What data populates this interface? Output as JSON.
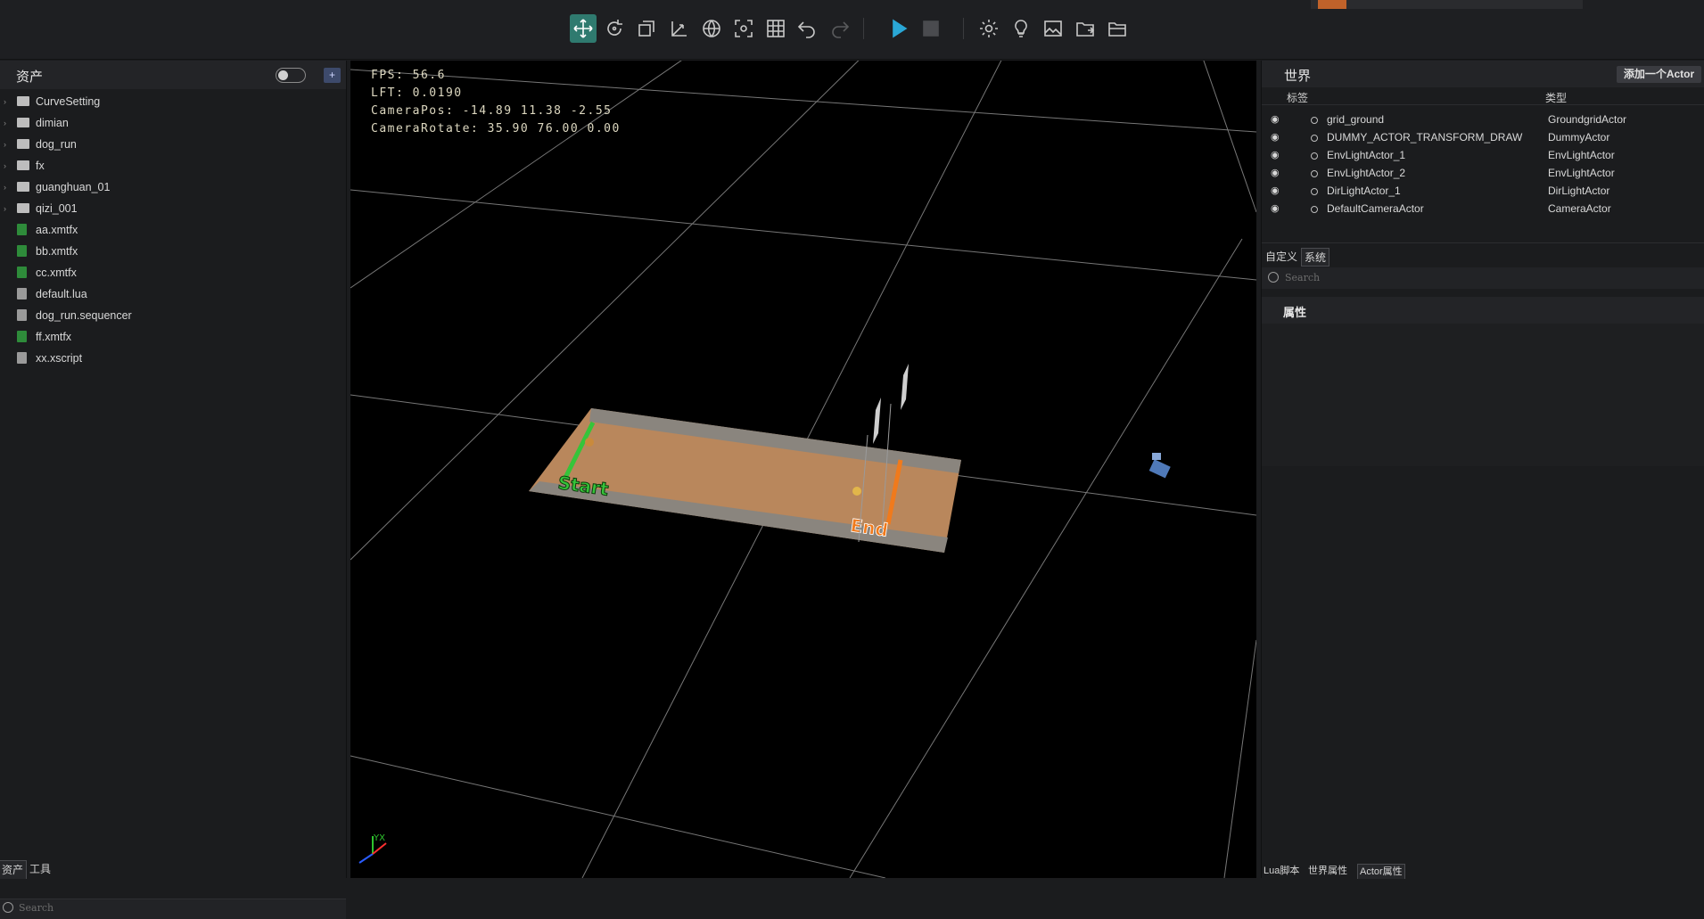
{
  "toolbar": {
    "buttons": [
      {
        "name": "move-icon"
      },
      {
        "name": "rotate-icon"
      },
      {
        "name": "scale-icon"
      },
      {
        "name": "axis-icon"
      },
      {
        "name": "globe-icon"
      },
      {
        "name": "focus-icon"
      },
      {
        "name": "grid-snap-icon"
      },
      {
        "name": "undo-icon"
      },
      {
        "name": "redo-icon"
      },
      {
        "name": "play-icon"
      },
      {
        "name": "stop-icon"
      },
      {
        "name": "settings-icon"
      },
      {
        "name": "light-bulb-icon"
      },
      {
        "name": "image-chart-icon"
      },
      {
        "name": "folder-export-icon"
      },
      {
        "name": "folder-open-icon"
      }
    ]
  },
  "assets": {
    "title": "资产",
    "items": [
      {
        "label": "CurveSetting",
        "kind": "folder"
      },
      {
        "label": "dimian",
        "kind": "folder"
      },
      {
        "label": "dog_run",
        "kind": "folder"
      },
      {
        "label": "fx",
        "kind": "folder"
      },
      {
        "label": "guanghuan_01",
        "kind": "folder"
      },
      {
        "label": "qizi_001",
        "kind": "folder"
      },
      {
        "label": "aa.xmtfx",
        "kind": "fx-file"
      },
      {
        "label": "bb.xmtfx",
        "kind": "fx-file"
      },
      {
        "label": "cc.xmtfx",
        "kind": "fx-file"
      },
      {
        "label": "default.lua",
        "kind": "lua-file"
      },
      {
        "label": "dog_run.sequencer",
        "kind": "sequencer-file"
      },
      {
        "label": "ff.xmtfx",
        "kind": "fx-file"
      },
      {
        "label": "xx.xscript",
        "kind": "script-file"
      }
    ],
    "search_placeholder": "Search",
    "bottom_tabs": [
      "资产",
      "工具"
    ]
  },
  "viewport": {
    "fps": "FPS: 56.6",
    "lft": "LFT: 0.0190",
    "camera_pos": "CameraPos: -14.89 11.38 -2.55",
    "camera_rotate": "CameraRotate: 35.90 76.00 0.00",
    "start_label": "Start",
    "end_label": "End",
    "axis_labels": "YX"
  },
  "world": {
    "title": "世界",
    "add_actor_label": "添加一个Actor",
    "col_tag": "标签",
    "col_type": "类型",
    "actors": [
      {
        "name": "grid_ground",
        "type": "GroundgridActor"
      },
      {
        "name": "DUMMY_ACTOR_TRANSFORM_DRAW",
        "type": "DummyActor"
      },
      {
        "name": "EnvLightActor_1",
        "type": "EnvLightActor"
      },
      {
        "name": "EnvLightActor_2",
        "type": "EnvLightActor"
      },
      {
        "name": "DirLightActor_1",
        "type": "DirLightActor"
      },
      {
        "name": "DefaultCameraActor",
        "type": "CameraActor"
      }
    ],
    "tab_custom": "自定义",
    "tab_system": "系统",
    "search_placeholder": "Search",
    "props_title": "属性",
    "bottom_tabs": [
      "Lua脚本",
      "世界属性",
      "Actor属性"
    ]
  },
  "colors": {
    "accent": "#2f7a6f",
    "play": "#2aa7d6",
    "start_green": "#36c43a",
    "end_orange": "#f07a1c"
  }
}
